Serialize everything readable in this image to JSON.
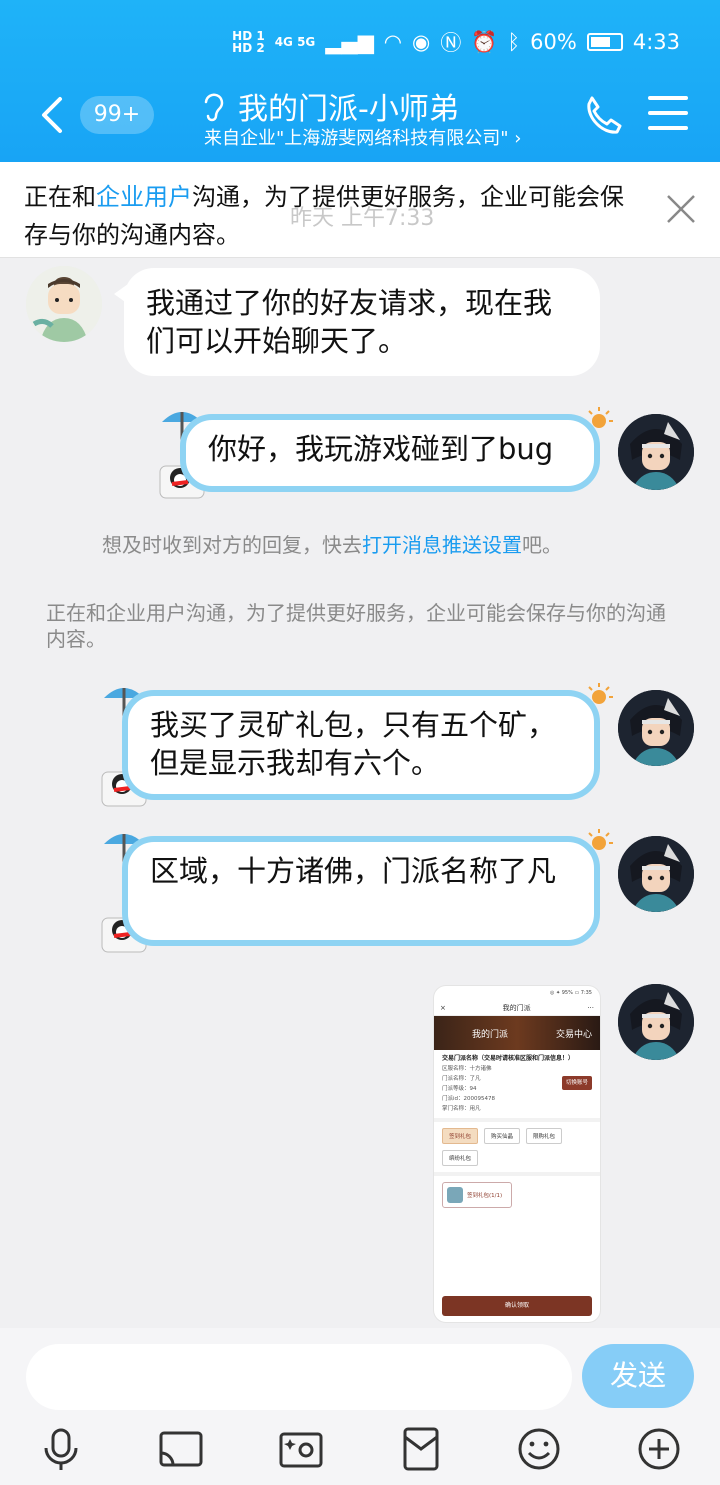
{
  "status_bar": {
    "sim": "HD 1\nHD 2",
    "network": "4G 5G",
    "battery": "60%",
    "time": "4:33"
  },
  "header": {
    "unread_badge": "99+",
    "title": "我的门派-小师弟",
    "subtitle": "来自企业\"上海游斐网络科技有限公司\"",
    "subtitle_chevron": "›"
  },
  "notice": {
    "text_before": "正在和",
    "highlight": "企业用户",
    "text_after": "沟通，为了提供更好服务，企业可能会保存与你的沟通内容。",
    "timestamp": "昨天 上午7:33"
  },
  "messages": [
    {
      "side": "left",
      "text": "我通过了你的好友请求，现在我们可以开始聊天了。"
    },
    {
      "side": "right",
      "text": "你好，我玩游戏碰到了bug"
    },
    {
      "side": "right",
      "text": "我买了灵矿礼包，只有五个矿，但是显示我却有六个。"
    },
    {
      "side": "right",
      "text": "区域，十方诸佛，门派名称了凡"
    }
  ],
  "system": {
    "push_before": "想及时收到对方的回复，快去",
    "push_link": "打开消息推送设置",
    "push_after": "吧。",
    "enterprise_notice": "正在和企业用户沟通，为了提供更好服务，企业可能会保存与你的沟通内容。"
  },
  "screenshot": {
    "status": "◎ ✦ 95% ▭ 7:35",
    "close": "×",
    "title": "我的门派",
    "more": "···",
    "banner_left": "我的门派",
    "banner_right": "交易中心",
    "info_heading": "交易门派名称（交易时请核准区服和门派信息！）",
    "info_lines": [
      "区服名称：十方诸佛",
      "门派名称：了凡",
      "门派等级：94",
      "门派id：200095478",
      "掌门名称：用凡"
    ],
    "switch_btn": "切换账号",
    "tabs": [
      "签到礼包",
      "购买仙晶",
      "限购礼包",
      "缤纷礼包"
    ],
    "gift": "签到礼包(1/1)",
    "confirm": "确认领取"
  },
  "input": {
    "placeholder": "",
    "send_label": "发送"
  }
}
